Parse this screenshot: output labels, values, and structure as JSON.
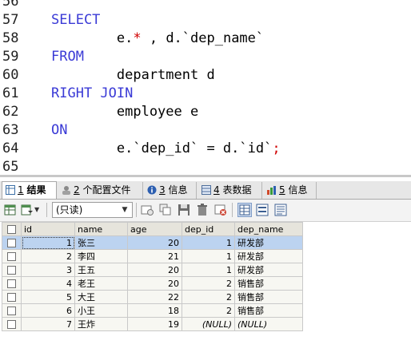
{
  "editor": {
    "lines": [
      {
        "num": "56",
        "segments": []
      },
      {
        "num": "57",
        "segments": [
          {
            "text": "SELECT",
            "style": "kw"
          }
        ]
      },
      {
        "num": "58",
        "segments": [
          {
            "text": "        e.",
            "style": "plain"
          },
          {
            "text": "*",
            "style": "str"
          },
          {
            "text": " , d.`dep_name`",
            "style": "plain"
          }
        ]
      },
      {
        "num": "59",
        "segments": [
          {
            "text": "FROM",
            "style": "kw"
          }
        ]
      },
      {
        "num": "60",
        "segments": [
          {
            "text": "        department d",
            "style": "plain"
          }
        ]
      },
      {
        "num": "61",
        "segments": [
          {
            "text": "RIGHT JOIN",
            "style": "kw"
          }
        ]
      },
      {
        "num": "62",
        "segments": [
          {
            "text": "        employee e",
            "style": "plain"
          }
        ]
      },
      {
        "num": "63",
        "segments": [
          {
            "text": "ON",
            "style": "kw"
          }
        ]
      },
      {
        "num": "64",
        "segments": [
          {
            "text": "        e.`dep_id` = d.`id`",
            "style": "plain"
          },
          {
            "text": ";",
            "style": "str"
          }
        ]
      },
      {
        "num": "65",
        "segments": []
      }
    ]
  },
  "tabs": [
    {
      "num": "1",
      "label": "结果",
      "icon": "result-grid-icon"
    },
    {
      "num": "2",
      "label": "个配置文件",
      "icon": "profile-icon"
    },
    {
      "num": "3",
      "label": "信息",
      "icon": "info-icon"
    },
    {
      "num": "4",
      "label": "表数据",
      "icon": "table-data-icon"
    },
    {
      "num": "5",
      "label": "信息",
      "icon": "info-chart-icon"
    }
  ],
  "toolbar": {
    "mode_value": "(只读)"
  },
  "grid": {
    "columns": [
      "id",
      "name",
      "age",
      "dep_id",
      "dep_name"
    ],
    "rows": [
      [
        "1",
        "张三",
        "20",
        "1",
        "研发部"
      ],
      [
        "2",
        "李四",
        "21",
        "1",
        "研发部"
      ],
      [
        "3",
        "王五",
        "20",
        "1",
        "研发部"
      ],
      [
        "4",
        "老王",
        "20",
        "2",
        "销售部"
      ],
      [
        "5",
        "大王",
        "22",
        "2",
        "销售部"
      ],
      [
        "6",
        "小王",
        "18",
        "2",
        "销售部"
      ],
      [
        "7",
        "王炸",
        "19",
        "(NULL)",
        "(NULL)"
      ]
    ]
  }
}
